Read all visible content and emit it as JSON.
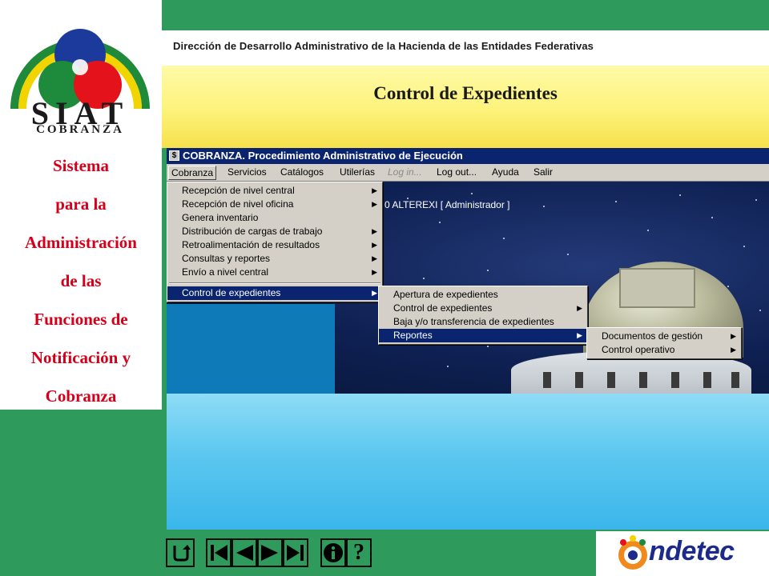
{
  "logo": {
    "name": "SIAT",
    "subtitle": "COBRANZA"
  },
  "system_title": {
    "lines": [
      "Sistema",
      "para la",
      "Administración",
      "de las",
      "Funciones de",
      "Notificación y",
      "Cobranza"
    ]
  },
  "header": {
    "text": "Dirección de Desarrollo Administrativo de la Hacienda de las Entidades Federativas"
  },
  "page_title": "Control de Expedientes",
  "app": {
    "icon_glyph": "$",
    "window_title": "COBRANZA. Procedimiento Administrativo de Ejecución",
    "menubar": [
      "Cobranza",
      "Servicios",
      "Catálogos",
      "Utilerías",
      "Log in...",
      "Log out...",
      "Ayuda",
      "Salir"
    ],
    "menubar_disabled": [
      "Log in..."
    ],
    "user_label": "0 ALTEREXI [ Administrador ]",
    "main_menu": [
      {
        "label": "Recepción de nivel central",
        "submenu": true
      },
      {
        "label": "Recepción de nivel oficina",
        "submenu": true
      },
      {
        "label": "Genera inventario",
        "submenu": false
      },
      {
        "label": "Distribución de cargas de trabajo",
        "submenu": true
      },
      {
        "label": "Retroalimentación de resultados",
        "submenu": true
      },
      {
        "label": "Consultas y reportes",
        "submenu": true
      },
      {
        "label": "Envío a nivel central",
        "submenu": true
      },
      {
        "label": "Control de expedientes",
        "submenu": true,
        "selected": true
      }
    ],
    "control_menu": [
      {
        "label": "Apertura de expedientes",
        "submenu": false
      },
      {
        "label": "Control de expedientes",
        "submenu": true
      },
      {
        "label": "Baja y/o transferencia de expedientes",
        "submenu": false
      },
      {
        "label": "Reportes",
        "submenu": true,
        "selected": true
      }
    ],
    "reportes_menu": [
      {
        "label": "Documentos de gestión",
        "submenu": true
      },
      {
        "label": "Control operativo",
        "submenu": true
      }
    ]
  },
  "nav": {
    "help_glyph": "?"
  },
  "footer_logo": {
    "text": "ndetec"
  },
  "colors": {
    "green": "#2e9a5c",
    "title_red": "#d4001a",
    "menu_highlight": "#0a2470",
    "indetec_blue": "#1c2a8a"
  }
}
